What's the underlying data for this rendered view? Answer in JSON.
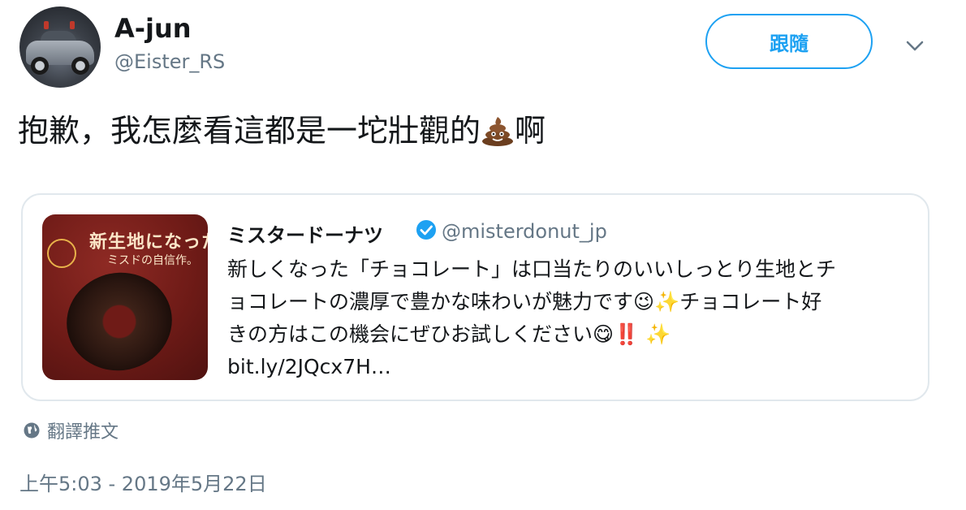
{
  "author": {
    "name": "A-jun",
    "handle": "@Eister_RS",
    "avatar_icon": "avatar-car-photo"
  },
  "header": {
    "follow_label": "跟隨",
    "more_icon": "chevron-down-icon"
  },
  "tweet": {
    "text_before_emoji": "抱歉，我怎麼看這都是一坨壯觀的",
    "emoji": "pile-of-poo-emoji",
    "text_after_emoji": "啊"
  },
  "quoted_tweet": {
    "name": "ミスタードーナツ",
    "handle": "@misterdonut_jp",
    "verified": true,
    "lines": [
      "新しくなった「チョコレート」は口当たりのいいしっとり生地とチ",
      "ョコレートの濃厚で豊かな味わいが魅力です😉✨チョコレート好",
      "きの方はこの機会にぜひお試しください😋‼️ ✨"
    ],
    "link": "bit.ly/2JQcx7H…",
    "image": {
      "title_line": "新生地になった",
      "subtitle_line": "ミスドの自信作。"
    }
  },
  "translate_label": "翻譯推文",
  "timestamp": "上午5:03 - 2019年5月22日",
  "colors": {
    "accent": "#1da1f2",
    "secondary_text": "#657786",
    "border": "#e1e8ed"
  }
}
